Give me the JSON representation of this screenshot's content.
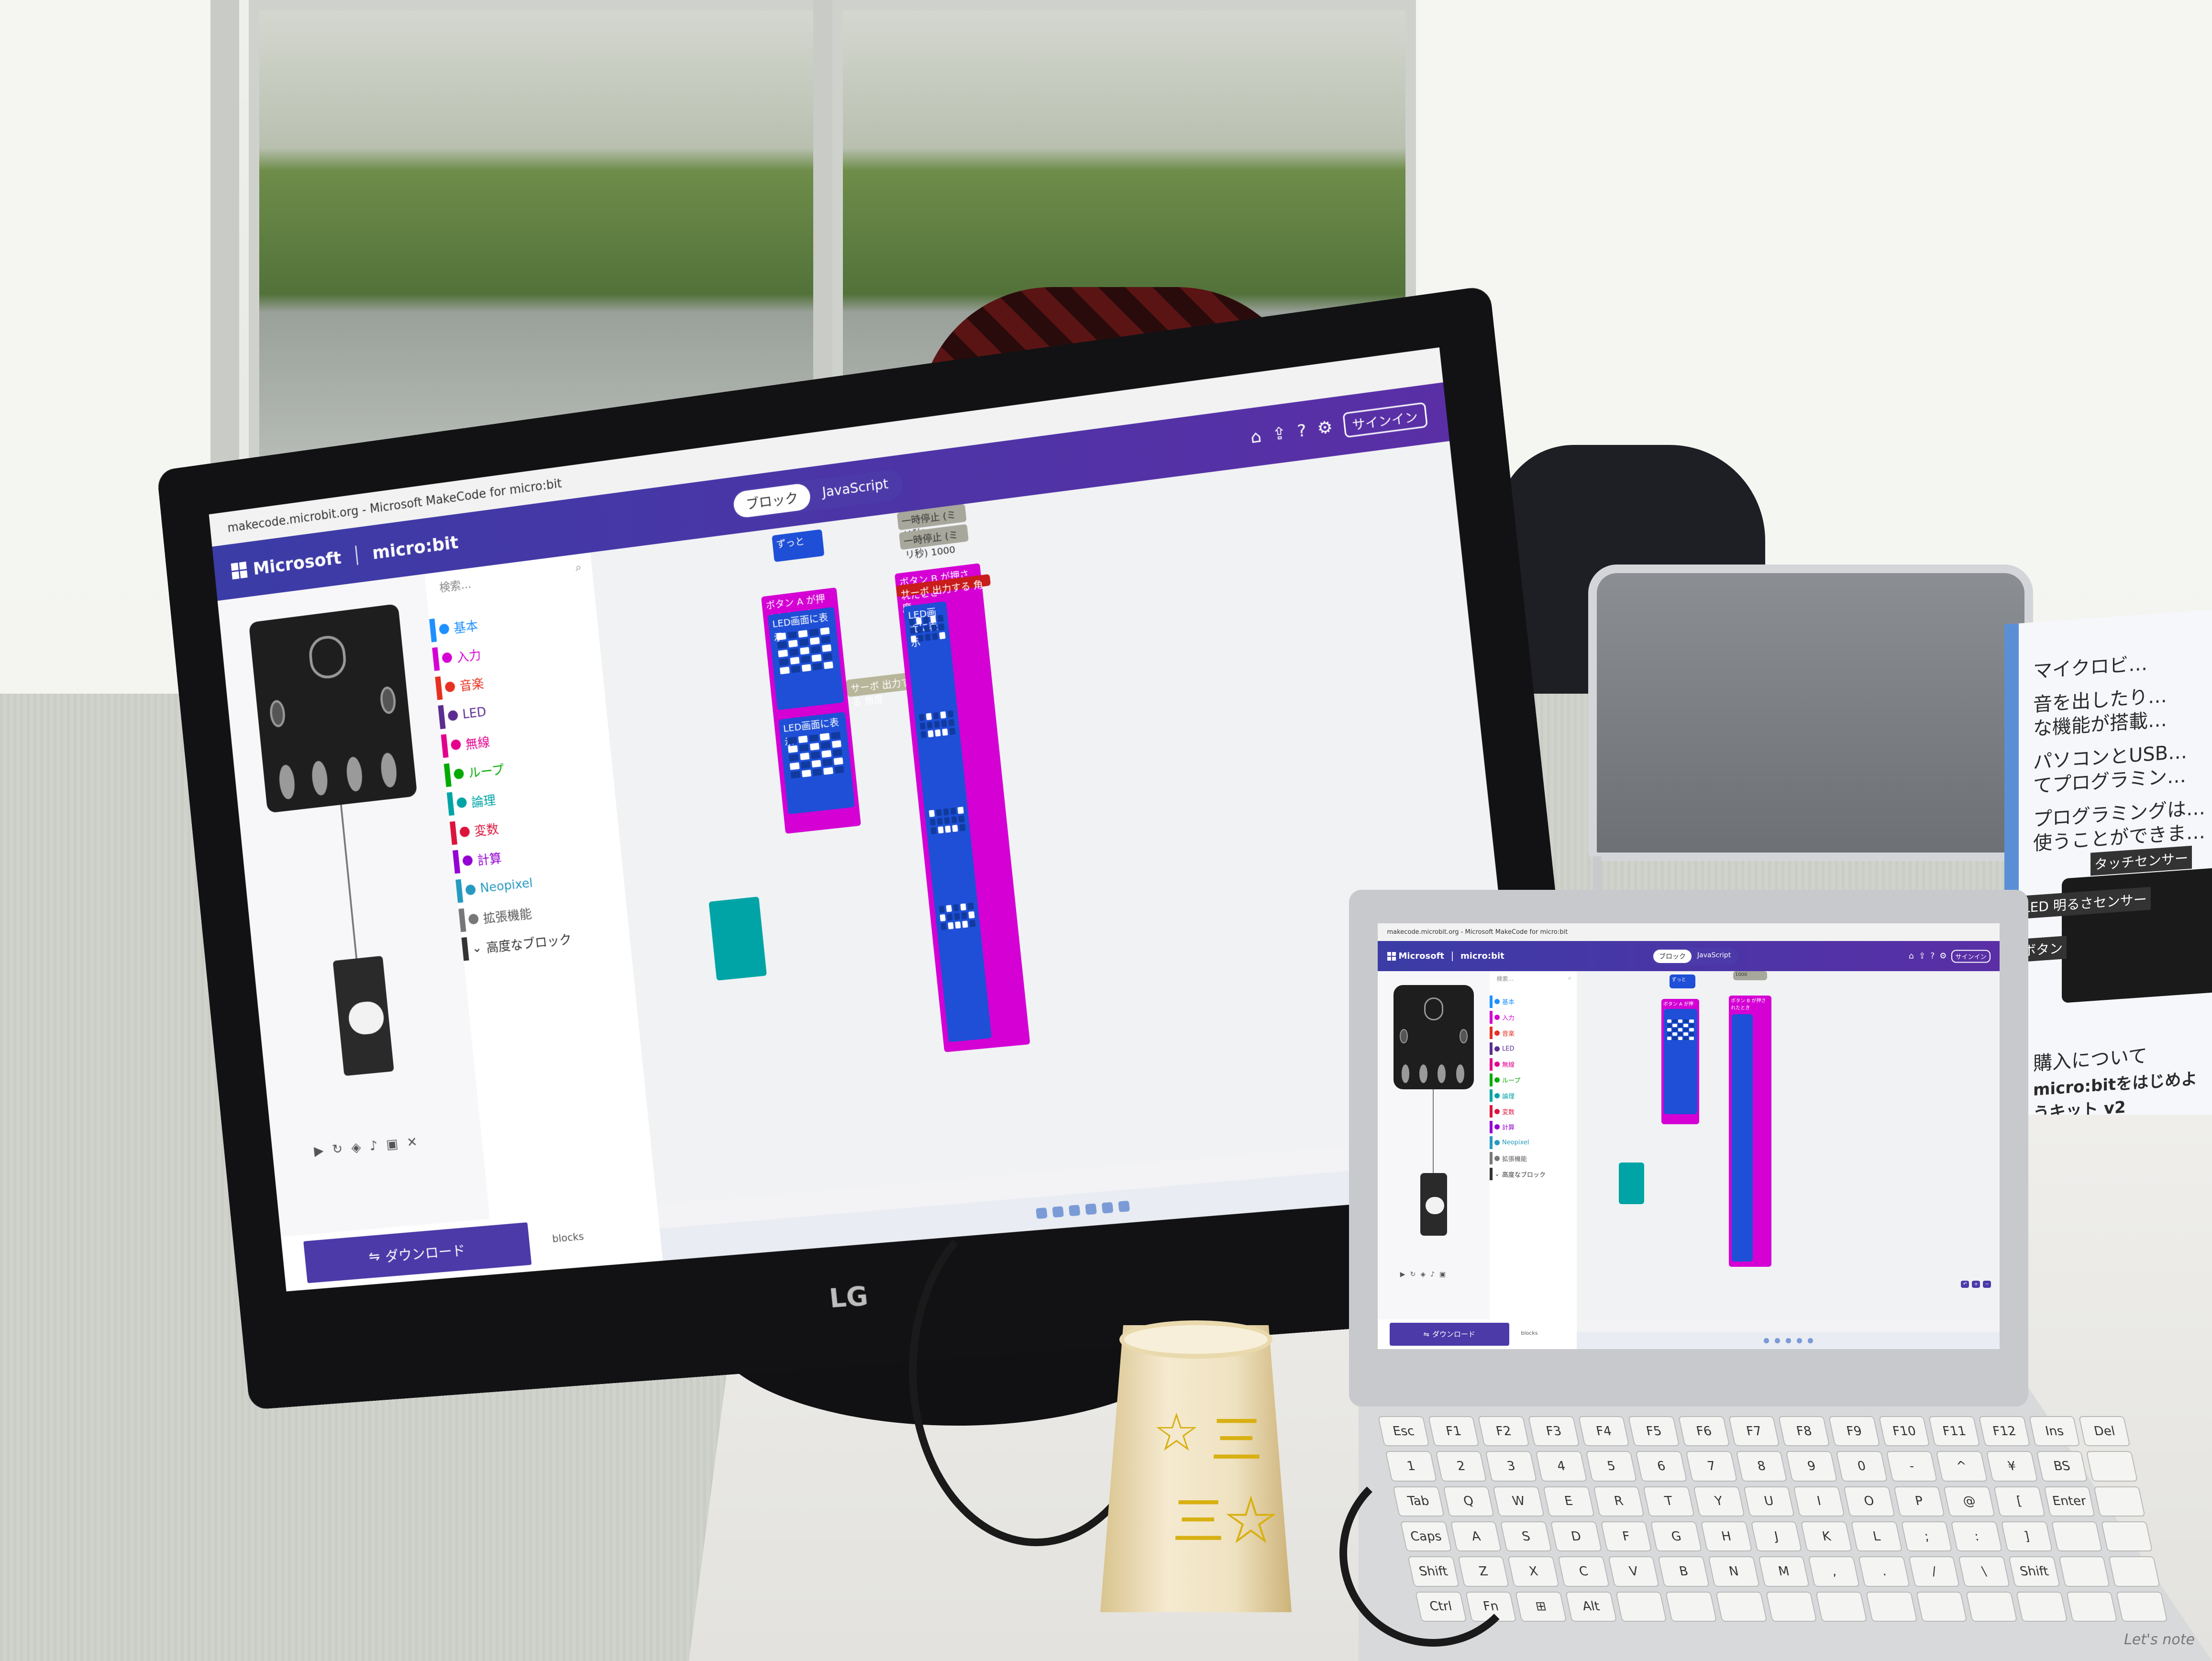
{
  "scene": {
    "monitor_brand": "LG",
    "laptop_brand": "Let's note",
    "cup_text": [
      "☆",
      "三",
      "三☆"
    ]
  },
  "poster": {
    "lines": [
      "マイクロビ…",
      "音を出したり…",
      "な機能が搭載…",
      "パソコンとUSB…",
      "てプログラミン…",
      "プログラミングは…",
      "使うことができま…"
    ],
    "labels": {
      "touch": "タッチセンサー",
      "led": "LED 明るさセンサー",
      "button": "ボタン"
    },
    "purchase_title": "購入について",
    "product": "micro:bitをはじめようキット v2"
  },
  "makecode": {
    "window_title": "makecode.microbit.org - Microsoft MakeCode for micro:bit",
    "brand_ms": "Microsoft",
    "brand_product": "micro:bit",
    "toggle": {
      "blocks": "ブロック",
      "javascript": "JavaScript"
    },
    "signin": "サインイン",
    "search_placeholder": "検索...",
    "categories": [
      {
        "label": "基本",
        "color": "#1e90ff"
      },
      {
        "label": "入力",
        "color": "#d400d4"
      },
      {
        "label": "音楽",
        "color": "#e63022"
      },
      {
        "label": "LED",
        "color": "#5c2d91"
      },
      {
        "label": "無線",
        "color": "#e3008c"
      },
      {
        "label": "ループ",
        "color": "#00aa00"
      },
      {
        "label": "論理",
        "color": "#00a4a6"
      },
      {
        "label": "変数",
        "color": "#dc143c"
      },
      {
        "label": "計算",
        "color": "#9400d3"
      },
      {
        "label": "Neopixel",
        "color": "#2699bf"
      },
      {
        "label": "拡張機能",
        "color": "#777777"
      },
      {
        "label": "高度なブロック",
        "color": "#333333"
      }
    ],
    "blocks": {
      "forever": "ずっと",
      "button_a": "ボタン A が押されたとき",
      "button_b": "ボタン B が押されたとき",
      "show_leds": "LED画面に表示",
      "servo": "サーボ 出力する 角度",
      "wait": "一時停止 (ミリ秒)",
      "wait_value": "1000"
    },
    "download": "ダウンロード",
    "filename": "blocks"
  }
}
